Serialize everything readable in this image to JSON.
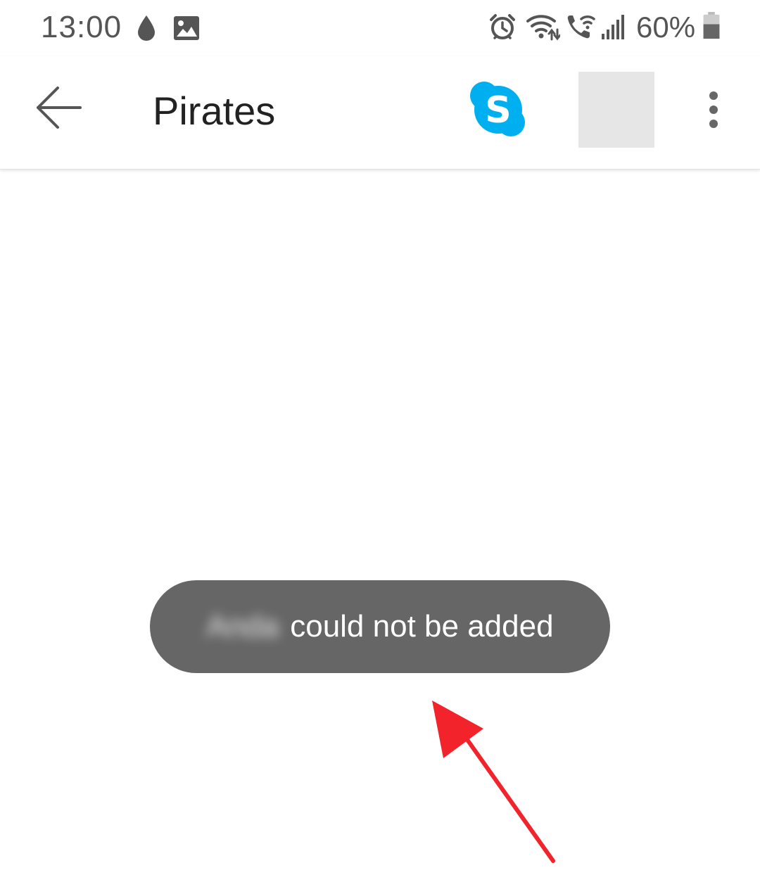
{
  "status_bar": {
    "time": "13:00",
    "battery_percent": "60%",
    "icons": [
      "droplet-icon",
      "image-icon",
      "alarm-icon",
      "wifi-icon",
      "wifi-calling-icon",
      "signal-icon",
      "battery-icon"
    ],
    "battery_level": 0.6
  },
  "app_bar": {
    "title": "Pirates",
    "back_icon": "arrow-back-icon",
    "call_icon": "skype-icon",
    "menu_icon": "more-vertical-icon"
  },
  "toast": {
    "name": "Anda",
    "message": "could not be added"
  },
  "colors": {
    "skype_blue": "#00aff0",
    "toast_background": "#666666",
    "annotation_arrow": "#f2232a",
    "text_primary": "#222222",
    "status_text": "#555555"
  }
}
